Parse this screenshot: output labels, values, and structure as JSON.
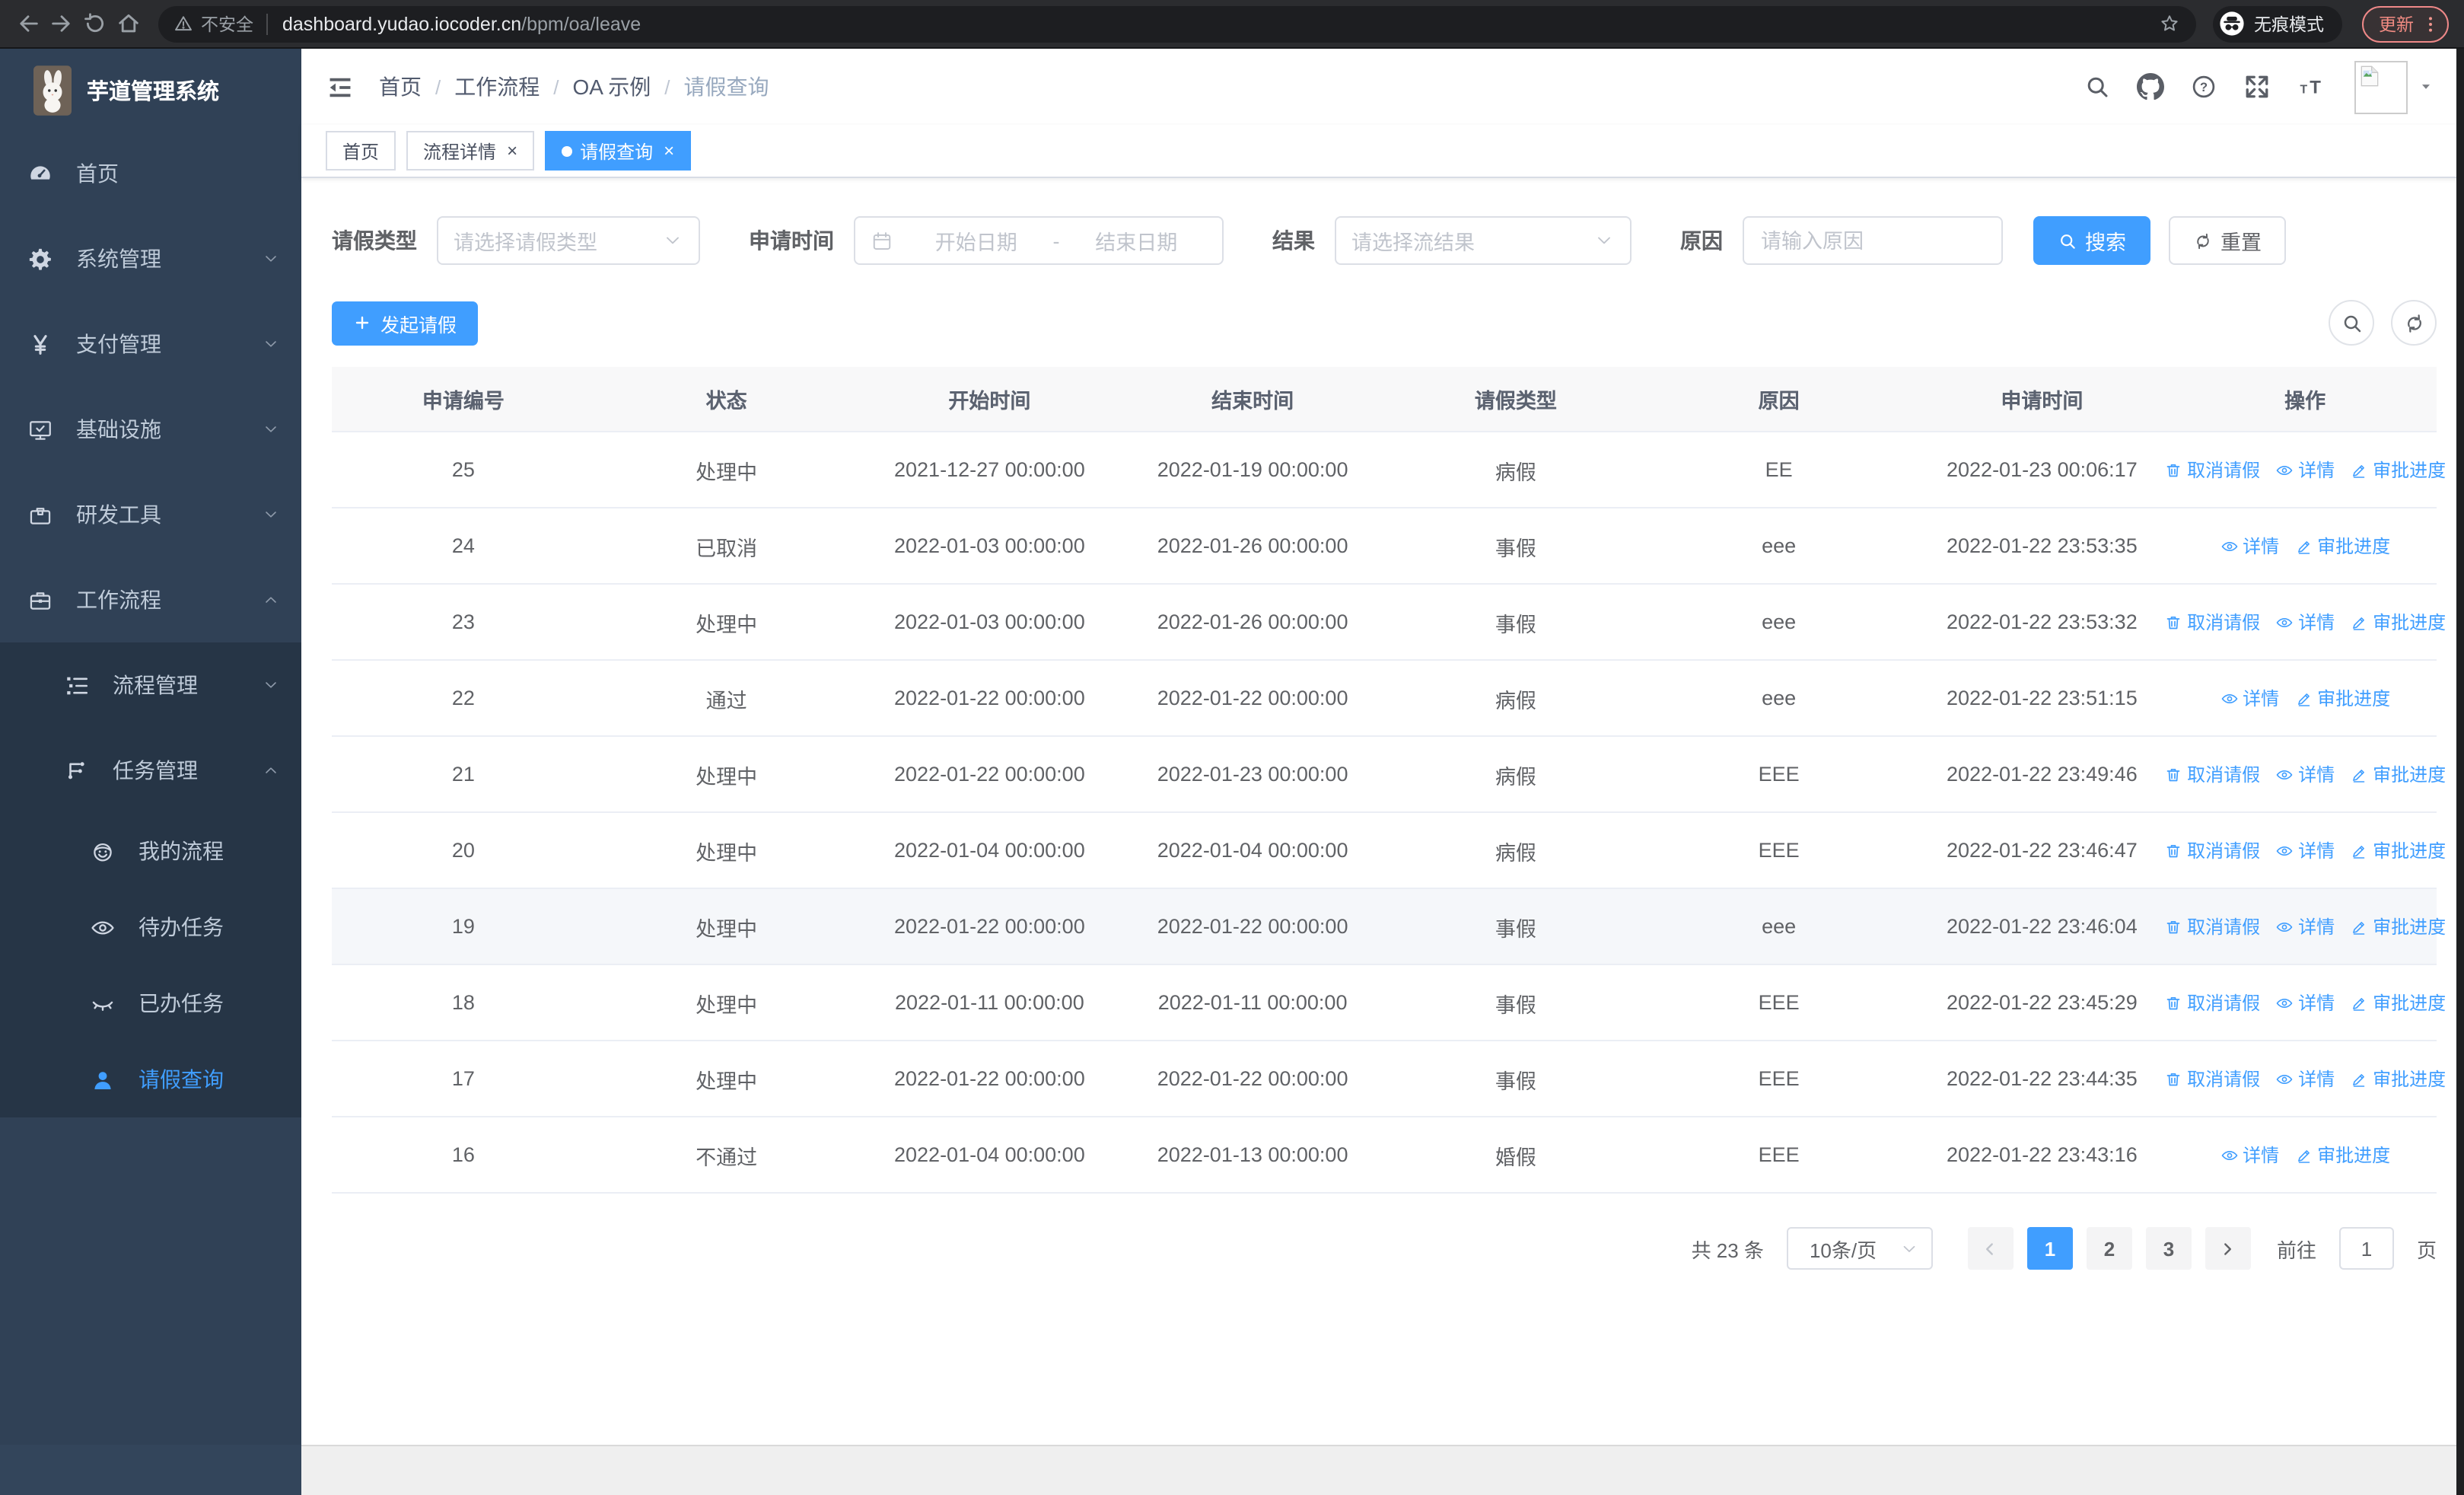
{
  "browser": {
    "security_label": "不安全",
    "url_host": "dashboard.yudao.iocoder.cn",
    "url_path": "/bpm/oa/leave",
    "incognito_label": "无痕模式",
    "update_label": "更新"
  },
  "sidebar": {
    "logo_title": "芋道管理系统",
    "menu": [
      {
        "name": "home",
        "label": "首页",
        "icon": "dashboard-icon"
      },
      {
        "name": "system-mgmt",
        "label": "系统管理",
        "icon": "gear-icon",
        "arrow": "down"
      },
      {
        "name": "payment-mgmt",
        "label": "支付管理",
        "icon": "yen-icon",
        "arrow": "down"
      },
      {
        "name": "infrastructure",
        "label": "基础设施",
        "icon": "monitor-icon",
        "arrow": "down"
      },
      {
        "name": "dev-tools",
        "label": "研发工具",
        "icon": "toolbox-icon",
        "arrow": "down"
      },
      {
        "name": "workflow",
        "label": "工作流程",
        "icon": "briefcase-icon",
        "arrow": "up",
        "children": [
          {
            "name": "process-mgmt",
            "label": "流程管理",
            "icon": "tree-icon",
            "arrow": "down"
          },
          {
            "name": "task-mgmt",
            "label": "任务管理",
            "icon": "flow-icon",
            "arrow": "up",
            "children": [
              {
                "name": "my-process",
                "label": "我的流程",
                "icon": "robot-icon"
              },
              {
                "name": "todo-task",
                "label": "待办任务",
                "icon": "eye-open-icon"
              },
              {
                "name": "done-task",
                "label": "已办任务",
                "icon": "eye-closed-icon"
              },
              {
                "name": "leave-query",
                "label": "请假查询",
                "icon": "user-icon",
                "active": true
              }
            ]
          }
        ]
      }
    ]
  },
  "topbar": {
    "breadcrumb": [
      "首页",
      "工作流程",
      "OA 示例",
      "请假查询"
    ]
  },
  "tabs": [
    {
      "name": "home",
      "label": "首页",
      "closable": false,
      "active": false
    },
    {
      "name": "process-detail",
      "label": "流程详情",
      "closable": true,
      "active": false
    },
    {
      "name": "leave-query",
      "label": "请假查询",
      "closable": true,
      "active": true
    }
  ],
  "filters": {
    "leave_type_label": "请假类型",
    "leave_type_placeholder": "请选择请假类型",
    "apply_time_label": "申请时间",
    "start_placeholder": "开始日期",
    "range_separator": "-",
    "end_placeholder": "结束日期",
    "result_label": "结果",
    "result_placeholder": "请选择流结果",
    "reason_label": "原因",
    "reason_placeholder": "请输入原因",
    "search_label": "搜索",
    "reset_label": "重置"
  },
  "toolbar": {
    "create_label": "发起请假"
  },
  "table": {
    "columns": [
      "申请编号",
      "状态",
      "开始时间",
      "结束时间",
      "请假类型",
      "原因",
      "申请时间",
      "操作"
    ],
    "action_labels": {
      "cancel": "取消请假",
      "detail": "详情",
      "progress": "审批进度"
    },
    "rows": [
      {
        "id": "25",
        "status": "处理中",
        "start": "2021-12-27 00:00:00",
        "end": "2022-01-19 00:00:00",
        "type": "病假",
        "reason": "EE",
        "applied": "2022-01-23 00:06:17",
        "actions": [
          "cancel",
          "detail",
          "progress"
        ],
        "highlight": false
      },
      {
        "id": "24",
        "status": "已取消",
        "start": "2022-01-03 00:00:00",
        "end": "2022-01-26 00:00:00",
        "type": "事假",
        "reason": "eee",
        "applied": "2022-01-22 23:53:35",
        "actions": [
          "detail",
          "progress"
        ],
        "highlight": false
      },
      {
        "id": "23",
        "status": "处理中",
        "start": "2022-01-03 00:00:00",
        "end": "2022-01-26 00:00:00",
        "type": "事假",
        "reason": "eee",
        "applied": "2022-01-22 23:53:32",
        "actions": [
          "cancel",
          "detail",
          "progress"
        ],
        "highlight": false
      },
      {
        "id": "22",
        "status": "通过",
        "start": "2022-01-22 00:00:00",
        "end": "2022-01-22 00:00:00",
        "type": "病假",
        "reason": "eee",
        "applied": "2022-01-22 23:51:15",
        "actions": [
          "detail",
          "progress"
        ],
        "highlight": false
      },
      {
        "id": "21",
        "status": "处理中",
        "start": "2022-01-22 00:00:00",
        "end": "2022-01-23 00:00:00",
        "type": "病假",
        "reason": "EEE",
        "applied": "2022-01-22 23:49:46",
        "actions": [
          "cancel",
          "detail",
          "progress"
        ],
        "highlight": false
      },
      {
        "id": "20",
        "status": "处理中",
        "start": "2022-01-04 00:00:00",
        "end": "2022-01-04 00:00:00",
        "type": "病假",
        "reason": "EEE",
        "applied": "2022-01-22 23:46:47",
        "actions": [
          "cancel",
          "detail",
          "progress"
        ],
        "highlight": false
      },
      {
        "id": "19",
        "status": "处理中",
        "start": "2022-01-22 00:00:00",
        "end": "2022-01-22 00:00:00",
        "type": "事假",
        "reason": "eee",
        "applied": "2022-01-22 23:46:04",
        "actions": [
          "cancel",
          "detail",
          "progress"
        ],
        "highlight": true
      },
      {
        "id": "18",
        "status": "处理中",
        "start": "2022-01-11 00:00:00",
        "end": "2022-01-11 00:00:00",
        "type": "事假",
        "reason": "EEE",
        "applied": "2022-01-22 23:45:29",
        "actions": [
          "cancel",
          "detail",
          "progress"
        ],
        "highlight": false
      },
      {
        "id": "17",
        "status": "处理中",
        "start": "2022-01-22 00:00:00",
        "end": "2022-01-22 00:00:00",
        "type": "事假",
        "reason": "EEE",
        "applied": "2022-01-22 23:44:35",
        "actions": [
          "cancel",
          "detail",
          "progress"
        ],
        "highlight": false
      },
      {
        "id": "16",
        "status": "不通过",
        "start": "2022-01-04 00:00:00",
        "end": "2022-01-13 00:00:00",
        "type": "婚假",
        "reason": "EEE",
        "applied": "2022-01-22 23:43:16",
        "actions": [
          "detail",
          "progress"
        ],
        "highlight": false
      }
    ]
  },
  "pagination": {
    "total_label": "共 23 条",
    "page_size": "10条/页",
    "pages": [
      "1",
      "2",
      "3"
    ],
    "active_page": "1",
    "goto_label": "前往",
    "goto_value": "1",
    "unit_label": "页"
  },
  "colors": {
    "primary": "#409eff",
    "sidebar_bg": "#304156",
    "submenu_bg": "#263546",
    "table_header_bg": "#f8f8f9",
    "update_badge": "#f28b82"
  }
}
